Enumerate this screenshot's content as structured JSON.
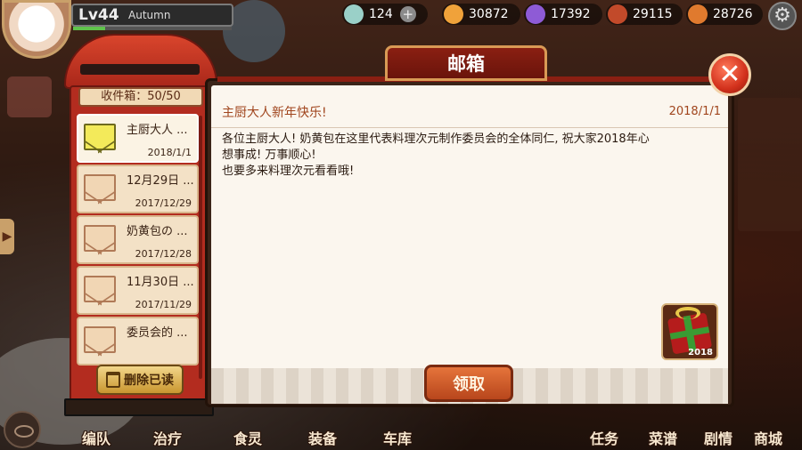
{
  "player": {
    "level": "Lv44",
    "name": "Autumn",
    "avatar_icon": "chef-avatar-icon"
  },
  "resources": [
    {
      "icon": "crystal-icon",
      "value": "124",
      "color": "#9ad0c8"
    },
    {
      "icon": "oil-icon",
      "value": "30872",
      "color": "#f0a23a"
    },
    {
      "icon": "gem-icon",
      "value": "17392",
      "color": "#8e5bd6"
    },
    {
      "icon": "chicken-icon",
      "value": "29115",
      "color": "#c24a2a"
    },
    {
      "icon": "vegetable-icon",
      "value": "28726",
      "color": "#e07a2e"
    }
  ],
  "mailbox": {
    "title": "邮箱",
    "inbox_count": "收件箱：50/50",
    "delete_read_label": "删除已读",
    "items": [
      {
        "title": "主厨大人 ...",
        "date": "2018/1/1",
        "unread": true
      },
      {
        "title": "12月29日 ...",
        "date": "2017/12/29",
        "unread": false
      },
      {
        "title": "奶黄包の ...",
        "date": "2017/12/28",
        "unread": false
      },
      {
        "title": "11月30日 ...",
        "date": "2017/11/29",
        "unread": false
      },
      {
        "title": "委员会的 ...",
        "date": "",
        "unread": false
      }
    ]
  },
  "mail": {
    "subject": "主厨大人新年快乐!",
    "date": "2018/1/1",
    "body": "各位主厨大人! 奶黄包在这里代表料理次元制作委员会的全体同仁, 祝大家2018年心\n想事成! 万事顺心!\n也要多来料理次元看看哦!",
    "attachment_label": "2018",
    "claim_label": "领取"
  },
  "bottom_nav": [
    {
      "label": "编队"
    },
    {
      "label": "治疗"
    },
    {
      "label": "食灵"
    },
    {
      "label": "装备"
    },
    {
      "label": "车库"
    },
    {
      "label": "任务"
    },
    {
      "label": "菜谱"
    },
    {
      "label": "剧情"
    },
    {
      "label": "商城"
    }
  ]
}
